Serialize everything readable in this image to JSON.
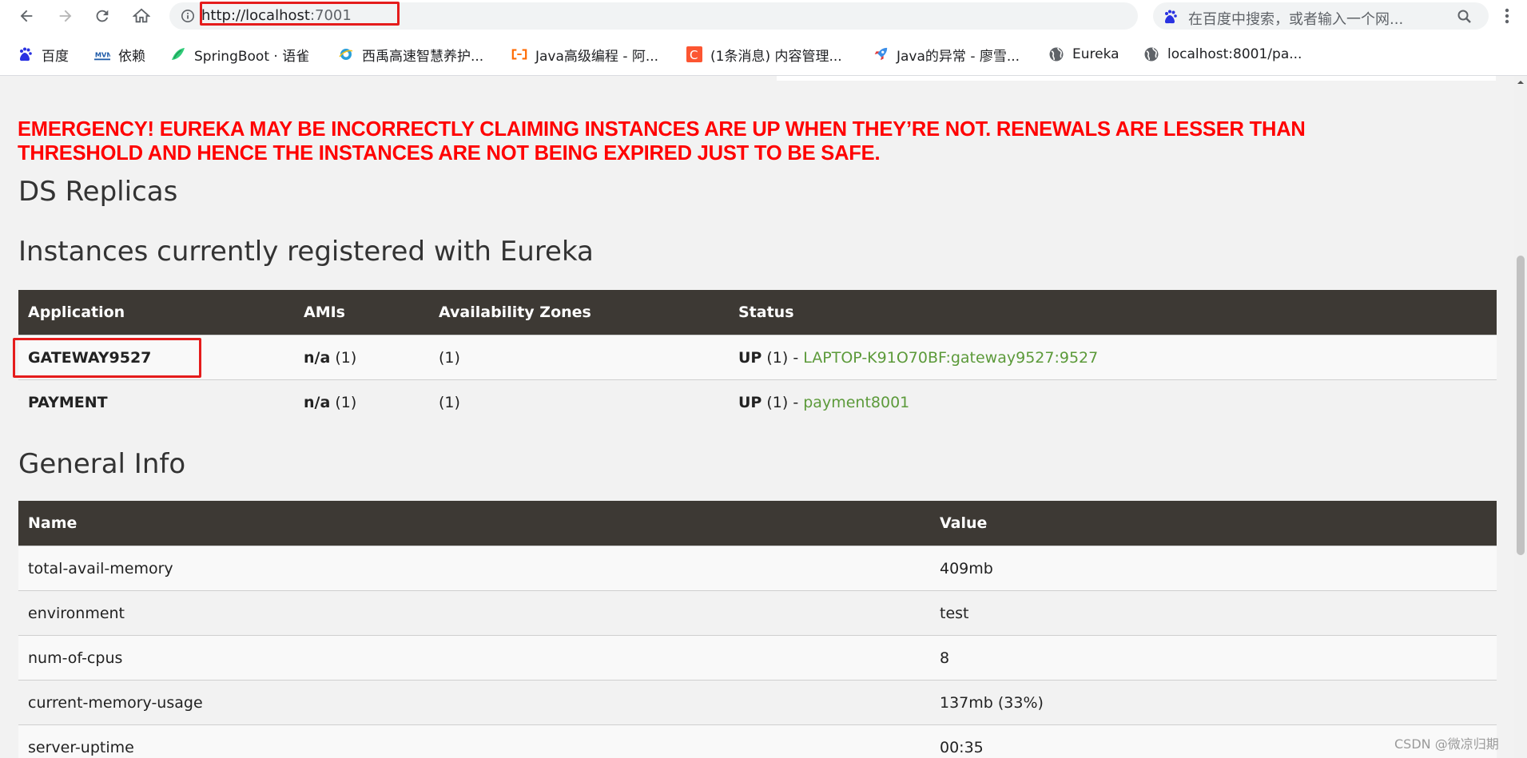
{
  "browser": {
    "url_main": "http://localhost",
    "url_port": ":7001",
    "search_placeholder": "在百度中搜索，或者输入一个网...",
    "bookmarks": [
      {
        "label": "百度",
        "icon": "baidu-paw-icon"
      },
      {
        "label": "依赖",
        "icon": "mvn-icon"
      },
      {
        "label": "SpringBoot · 语雀",
        "icon": "yuque-bird-icon"
      },
      {
        "label": "西禹高速智慧养护...",
        "icon": "ie-globe-icon"
      },
      {
        "label": "Java高级编程 - 阿...",
        "icon": "aliyun-bracket-icon"
      },
      {
        "label": "(1条消息) 内容管理...",
        "icon": "csdn-c-icon"
      },
      {
        "label": "Java的异常 - 廖雪...",
        "icon": "rocket-icon"
      },
      {
        "label": "Eureka",
        "icon": "globe-icon"
      },
      {
        "label": "localhost:8001/pa...",
        "icon": "globe-icon"
      }
    ]
  },
  "page": {
    "emergency_line1": "EMERGENCY! EUREKA MAY BE INCORRECTLY CLAIMING INSTANCES ARE UP WHEN THEY’RE NOT. RENEWALS ARE LESSER THAN",
    "emergency_line2": "THRESHOLD AND HENCE THE INSTANCES ARE NOT BEING EXPIRED JUST TO BE SAFE.",
    "ds_replicas_title": "DS Replicas",
    "instances_title": "Instances currently registered with Eureka",
    "instances_headers": [
      "Application",
      "AMIs",
      "Availability Zones",
      "Status"
    ],
    "instances": [
      {
        "application": "GATEWAY9527",
        "ami_bold": "n/a",
        "ami_count": " (1)",
        "zones": "(1)",
        "status_prefix": "UP",
        "status_count": " (1) - ",
        "status_link": "LAPTOP-K91O70BF:gateway9527:9527"
      },
      {
        "application": "PAYMENT",
        "ami_bold": "n/a",
        "ami_count": " (1)",
        "zones": "(1)",
        "status_prefix": "UP",
        "status_count": " (1) - ",
        "status_link": "payment8001"
      }
    ],
    "general_title": "General Info",
    "general_headers": [
      "Name",
      "Value"
    ],
    "general_rows": [
      {
        "name": "total-avail-memory",
        "value": "409mb"
      },
      {
        "name": "environment",
        "value": "test"
      },
      {
        "name": "num-of-cpus",
        "value": "8"
      },
      {
        "name": "current-memory-usage",
        "value": "137mb (33%)"
      },
      {
        "name": "server-uptime",
        "value": "00:35"
      }
    ]
  },
  "watermark": "CSDN @微凉归期",
  "colors": {
    "emergency": "#ff0000",
    "table_header": "#3d3934",
    "link_green": "#5c9a3a",
    "highlight_box": "#e51c1c",
    "star_blue": "#1a73e8"
  }
}
